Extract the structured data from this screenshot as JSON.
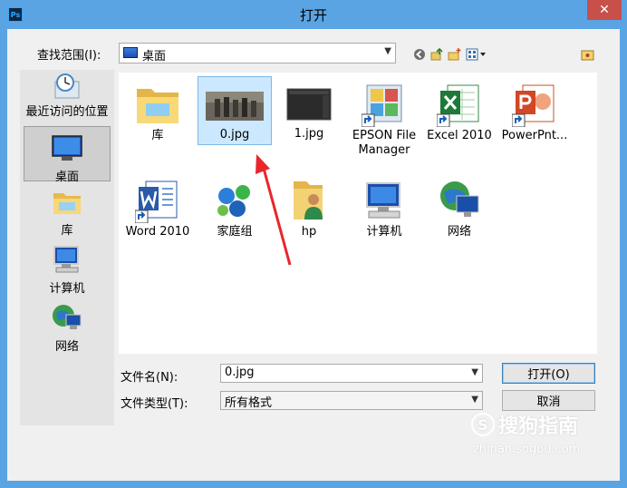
{
  "window": {
    "app_badge": "Ps",
    "title": "打开",
    "close_glyph": "✕"
  },
  "lookin": {
    "label": "查找范围(I):",
    "value": "桌面"
  },
  "places": [
    {
      "label": "最近访问的位置",
      "icon": "recent-places-icon"
    },
    {
      "label": "桌面",
      "icon": "desktop-icon"
    },
    {
      "label": "库",
      "icon": "libraries-icon"
    },
    {
      "label": "计算机",
      "icon": "computer-icon"
    },
    {
      "label": "网络",
      "icon": "network-icon"
    }
  ],
  "files": [
    {
      "label": "库",
      "icon": "libraries-folder-icon"
    },
    {
      "label": "0.jpg",
      "icon": "image-thumbnail-icon"
    },
    {
      "label": "1.jpg",
      "icon": "dark-thumbnail-icon"
    },
    {
      "label": "EPSON File",
      "label2": "Manager",
      "icon": "epson-shortcut-icon"
    },
    {
      "label": "Excel 2010",
      "icon": "excel-shortcut-icon"
    },
    {
      "label": "PowerPnt...",
      "icon": "powerpoint-shortcut-icon"
    },
    {
      "label": "Word 2010",
      "icon": "word-shortcut-icon"
    },
    {
      "label": "家庭组",
      "icon": "homegroup-icon"
    },
    {
      "label": "hp",
      "icon": "user-folder-icon"
    },
    {
      "label": "计算机",
      "icon": "computer-icon"
    },
    {
      "label": "网络",
      "icon": "network-icon"
    }
  ],
  "filename": {
    "label": "文件名(N):",
    "value": "0.jpg"
  },
  "filetype": {
    "label": "文件类型(T):",
    "value": "所有格式"
  },
  "buttons": {
    "open": "打开(O)",
    "cancel": "取消"
  },
  "watermark": {
    "logo_glyph": "S",
    "brand": "搜狗指南",
    "url": "zhinan.sogou.com"
  },
  "colors": {
    "titlebar": "#5aa4e4",
    "selection": "#cce8ff",
    "close": "#c7504b",
    "annotation_arrow": "#e8262c"
  }
}
